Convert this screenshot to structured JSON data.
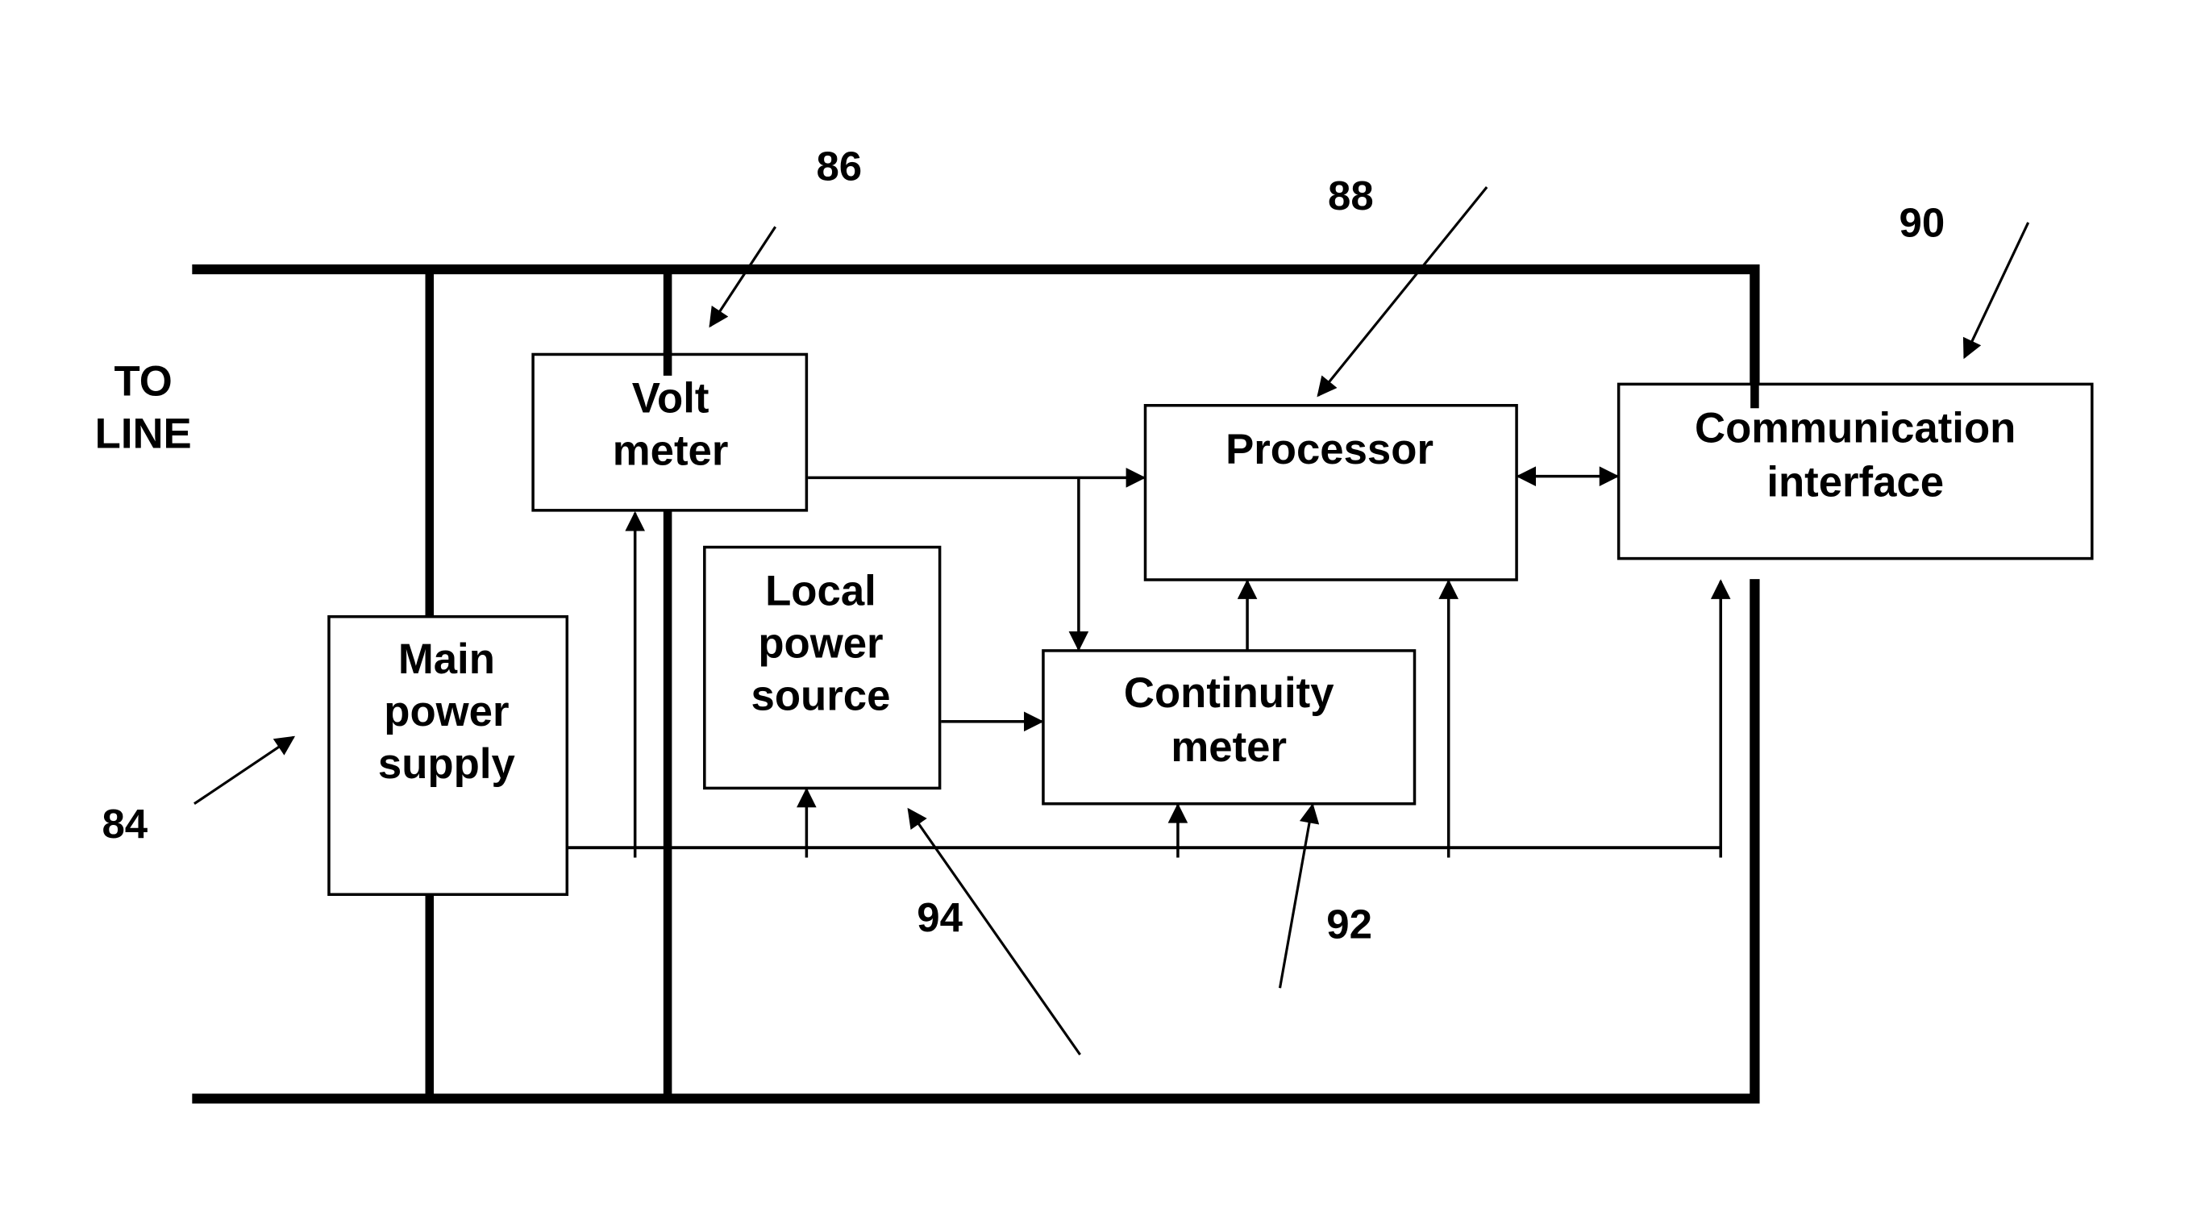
{
  "diagram": {
    "line_label": [
      "TO",
      "LINE"
    ],
    "blocks": {
      "main_power_supply": {
        "lines": [
          "Main",
          "power",
          "supply"
        ],
        "ref": "84"
      },
      "volt_meter": {
        "lines": [
          "Volt",
          "meter"
        ],
        "ref": "86"
      },
      "processor": {
        "lines": [
          "Processor"
        ],
        "ref": "88"
      },
      "communication_interface": {
        "lines": [
          "Communication",
          "interface"
        ],
        "ref": "90"
      },
      "continuity_meter": {
        "lines": [
          "Continuity",
          "meter"
        ],
        "ref": "92"
      },
      "local_power_source": {
        "lines": [
          "Local",
          "power",
          "source"
        ],
        "ref": "94"
      }
    },
    "colors": {
      "ink": "#000000",
      "background": "#ffffff"
    }
  }
}
